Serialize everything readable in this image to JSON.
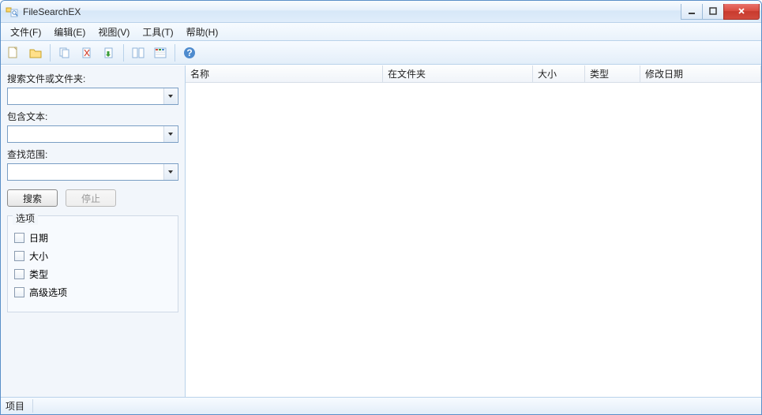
{
  "window": {
    "title": "FileSearchEX"
  },
  "menu": {
    "file": "文件(F)",
    "edit": "编辑(E)",
    "view": "视图(V)",
    "tools": "工具(T)",
    "help": "帮助(H)"
  },
  "sidebar": {
    "search_files_label": "搜索文件或文件夹:",
    "search_files_value": "",
    "contains_text_label": "包含文本:",
    "contains_text_value": "",
    "look_in_label": "查找范围:",
    "look_in_value": "",
    "search_btn": "搜索",
    "stop_btn": "停止",
    "options_title": "选项",
    "opt_date": "日期",
    "opt_size": "大小",
    "opt_type": "类型",
    "opt_advanced": "高级选项"
  },
  "columns": {
    "name": "名称",
    "in_folder": "在文件夹",
    "size": "大小",
    "type": "类型",
    "modified": "修改日期"
  },
  "status": {
    "items": "项目"
  }
}
